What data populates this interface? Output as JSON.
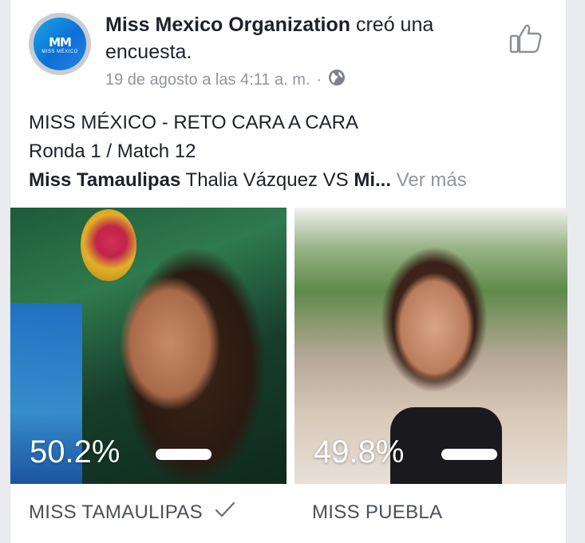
{
  "post": {
    "author": "Miss Mexico Organization",
    "action": "creó una encuesta.",
    "timestamp": "19 de agosto a las 4:11 a. m.",
    "separator": "·",
    "avatar_text": "MM",
    "avatar_subtext": "MISS MÉXICO",
    "text_line1": "MISS MÉXICO - RETO CARA A CARA",
    "text_line2": "Ronda 1 / Match 12",
    "text_line3_bold1": "Miss Tamaulipas",
    "text_line3_rest": " Thalia Vázquez VS ",
    "text_line3_bold2": "Mi...",
    "see_more": "Ver más"
  },
  "poll": {
    "options": [
      {
        "label": "MISS TAMAULIPAS",
        "percent": "50.2%",
        "fraction": 0.502,
        "selected": true
      },
      {
        "label": "MISS PUEBLA",
        "percent": "49.8%",
        "fraction": 0.498,
        "selected": false
      }
    ]
  },
  "colors": {
    "text": "#1d2129",
    "meta": "#90949c",
    "option_label": "#4b4f56",
    "bar": "#ffffff"
  },
  "icons": {
    "like": "thumbs-up-icon",
    "privacy": "globe-icon",
    "vote": "check-icon"
  }
}
